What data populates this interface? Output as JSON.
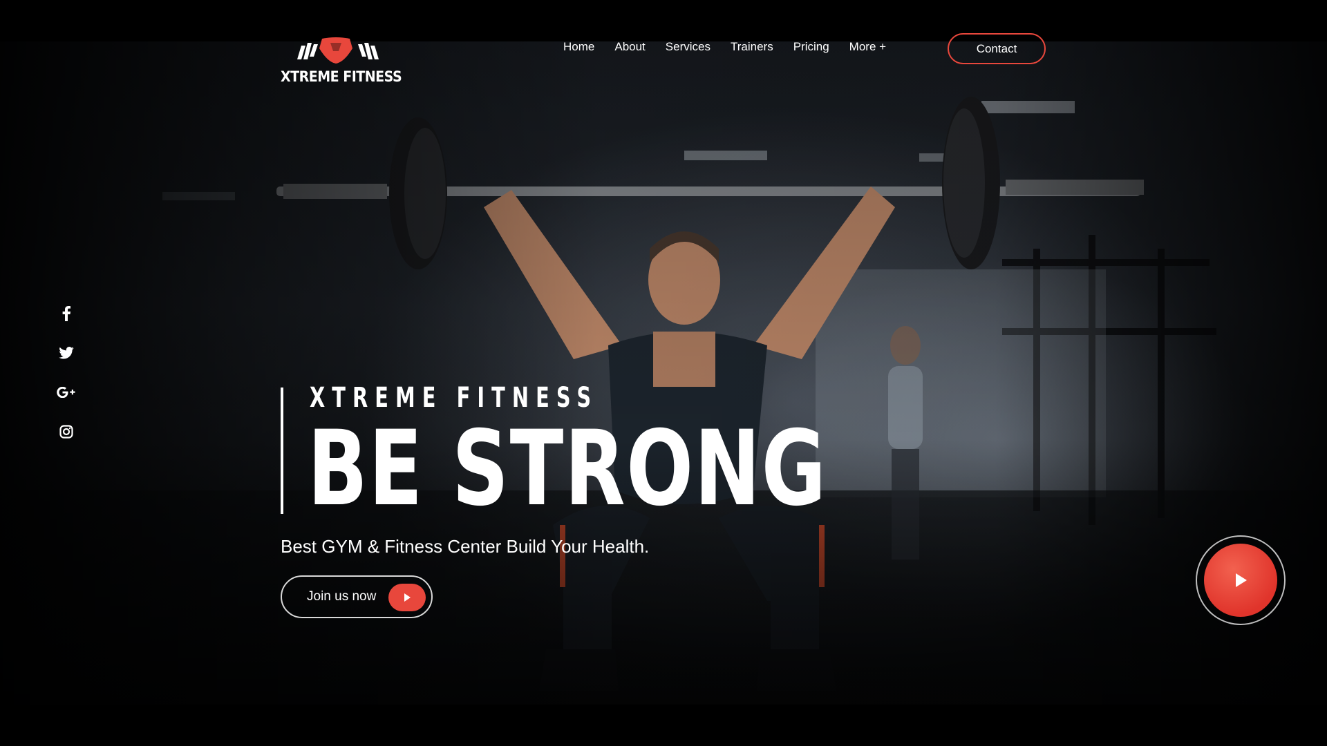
{
  "brand": {
    "name": "XTREME FITNESS",
    "accent_color": "#e8473c"
  },
  "nav": {
    "items": [
      {
        "label": "Home"
      },
      {
        "label": "About"
      },
      {
        "label": "Services"
      },
      {
        "label": "Trainers"
      },
      {
        "label": "Pricing"
      },
      {
        "label": "More +"
      }
    ],
    "contact_label": "Contact"
  },
  "social": {
    "icons": [
      "facebook-icon",
      "twitter-icon",
      "google-plus-icon",
      "instagram-icon"
    ]
  },
  "hero": {
    "kicker": "XTREME FITNESS",
    "headline": "BE STRONG",
    "subtitle": "Best GYM & Fitness Center Build Your Health.",
    "cta_label": "Join us now",
    "cta_icon": "play-icon",
    "video_icon": "play-icon"
  }
}
